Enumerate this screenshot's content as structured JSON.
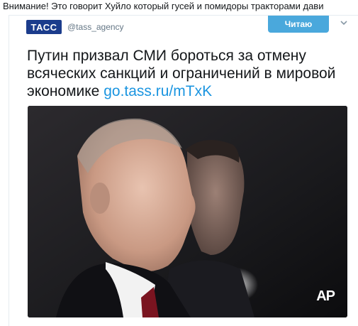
{
  "caption": "Внимание! Это говорит Хуйло который гусей и помидоры тракторами дави",
  "tweet": {
    "logo_text": "ТАСС",
    "handle": "@tass_agency",
    "follow_label": "Читаю",
    "text": "Путин призвал СМИ бороться за отмену всяческих санкций и ограничений в мировой экономике",
    "link": "go.tass.ru/mTxK",
    "image_credit": "AP"
  },
  "icons": {
    "menu": "chevron-down-icon"
  },
  "colors": {
    "link": "#1b95e0",
    "follow_button": "#4aa8dc",
    "tass_brand": "#1b3c8c"
  }
}
